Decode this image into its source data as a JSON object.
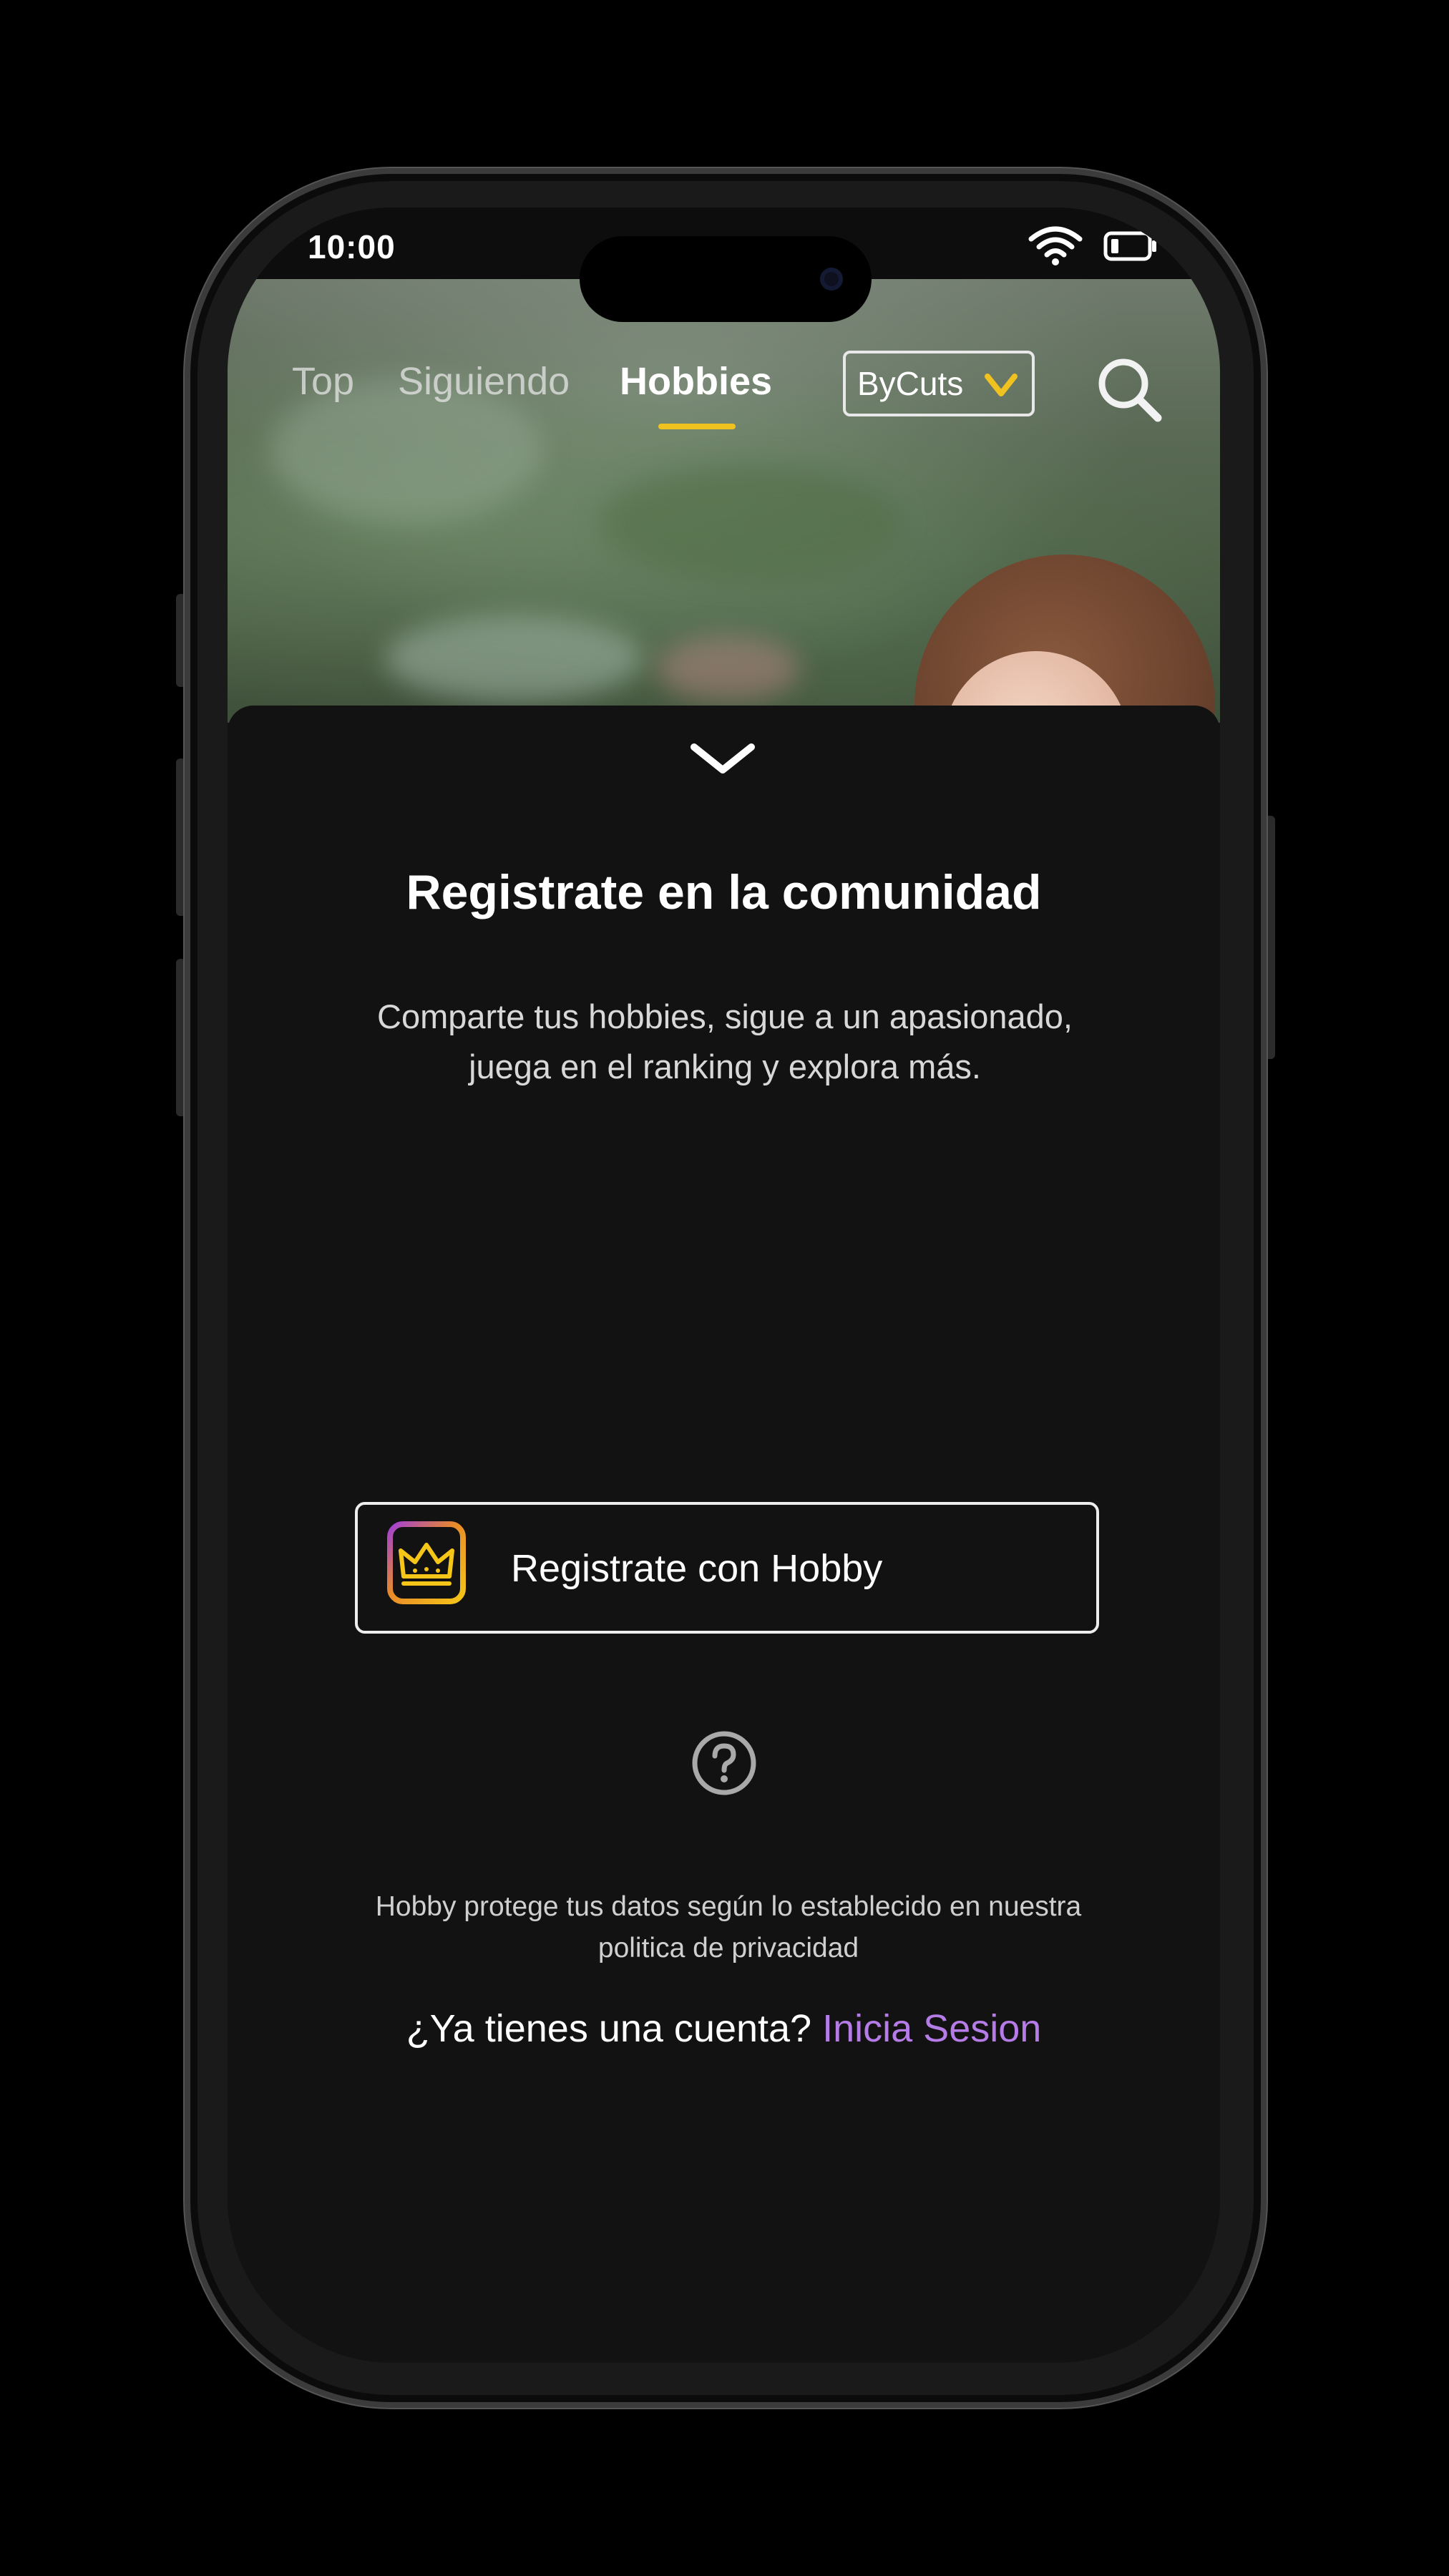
{
  "status_bar": {
    "time": "10:00"
  },
  "top_nav": {
    "tabs": [
      {
        "label": "Top",
        "active": false
      },
      {
        "label": "Siguiendo",
        "active": false
      },
      {
        "label": "Hobbies",
        "active": true
      }
    ],
    "brand_select": {
      "value": "ByCuts"
    },
    "search_icon": "search-icon",
    "accent_color": "#f0c21f"
  },
  "sheet": {
    "collapse_icon": "chevron-down-icon",
    "title": "Registrate en la comunidad",
    "subtitle": "Comparte tus hobbies, sigue a un apasionado, juega en el ranking y explora más.",
    "register_button": {
      "label": "Registrate con Hobby",
      "icon": "hobby-crown-logo"
    },
    "help_icon": "question-circle-icon",
    "privacy_text": "Hobby protege tus datos según lo establecido en nuestra politica de privacidad",
    "login_prompt": "¿Ya tienes una cuenta?",
    "login_link": "Inicia Sesion",
    "link_color": "#b57be6"
  }
}
